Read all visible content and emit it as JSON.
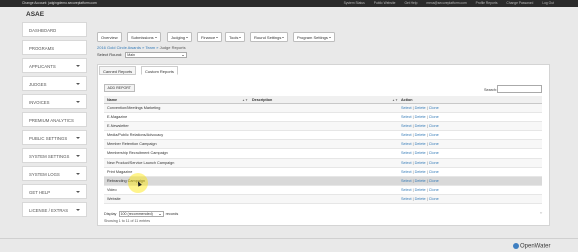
{
  "topbar": {
    "left_text": "Change Account: judgingdemo.secureplatform.com",
    "links": [
      "System Status",
      "Public Website",
      "Get Help",
      "mexa@secureplatform.com",
      "Profile Reports",
      "Change Password",
      "Log Out"
    ]
  },
  "brand": "ASAE",
  "sidebar": {
    "items": [
      {
        "label": "DASHBOARD",
        "has_chevron": false
      },
      {
        "label": "PROGRAMS",
        "has_chevron": false
      },
      {
        "label": "APPLICANTS",
        "has_chevron": true
      },
      {
        "label": "JUDGES",
        "has_chevron": true
      },
      {
        "label": "INVOICES",
        "has_chevron": true
      },
      {
        "label": "PREMIUM ANALYTICS",
        "has_chevron": false
      },
      {
        "label": "PUBLIC SETTINGS",
        "has_chevron": true
      },
      {
        "label": "SYSTEM SETTINGS",
        "has_chevron": true
      },
      {
        "label": "SYSTEM LOGS",
        "has_chevron": true
      },
      {
        "label": "GET HELP",
        "has_chevron": true
      },
      {
        "label": "LICENSE / EXTRAS",
        "has_chevron": true
      }
    ]
  },
  "navbar": {
    "buttons": [
      {
        "label": "Overview",
        "caret": false
      },
      {
        "label": "Submissions",
        "caret": true
      },
      {
        "label": "Judging",
        "caret": true
      },
      {
        "label": "Finance",
        "caret": true
      },
      {
        "label": "Tools",
        "caret": true
      },
      {
        "label": "Round Settings",
        "caret": true
      },
      {
        "label": "Program Settings",
        "caret": true
      }
    ]
  },
  "breadcrumb": {
    "items": [
      "2016 Gold Circle Awards",
      "Team"
    ],
    "current": "Judge Reports",
    "separator": " » "
  },
  "select_round": {
    "label": "Select Round:",
    "value": "Main"
  },
  "tabs": {
    "canned": "Canned Reports",
    "custom": "Custom Reports"
  },
  "add_report_label": "ADD REPORT",
  "search_label": "Search:",
  "table": {
    "headers": {
      "name": "Name",
      "description": "Description",
      "action": "Action"
    },
    "rows": [
      {
        "name": "Convention/Meetings Marketing"
      },
      {
        "name": "E-Magazine"
      },
      {
        "name": "E-Newsletter"
      },
      {
        "name": "Media/Public Relations/Advocacy"
      },
      {
        "name": "Member Retention Campaign"
      },
      {
        "name": "Membership Recruitment Campaign"
      },
      {
        "name": "New Product/Service Launch Campaign"
      },
      {
        "name": "Print Magazine"
      },
      {
        "name": "Rebranding Campaign"
      },
      {
        "name": "Video"
      },
      {
        "name": "Website"
      }
    ],
    "actions": [
      "Select",
      "Delete",
      "Clone"
    ],
    "action_separator": " | "
  },
  "display": {
    "prefix": "Display",
    "value": "100 (recommended)",
    "suffix": "records"
  },
  "showing_text": "Showing 1 to 11 of 11 entries",
  "watermark": "OpenWater"
}
